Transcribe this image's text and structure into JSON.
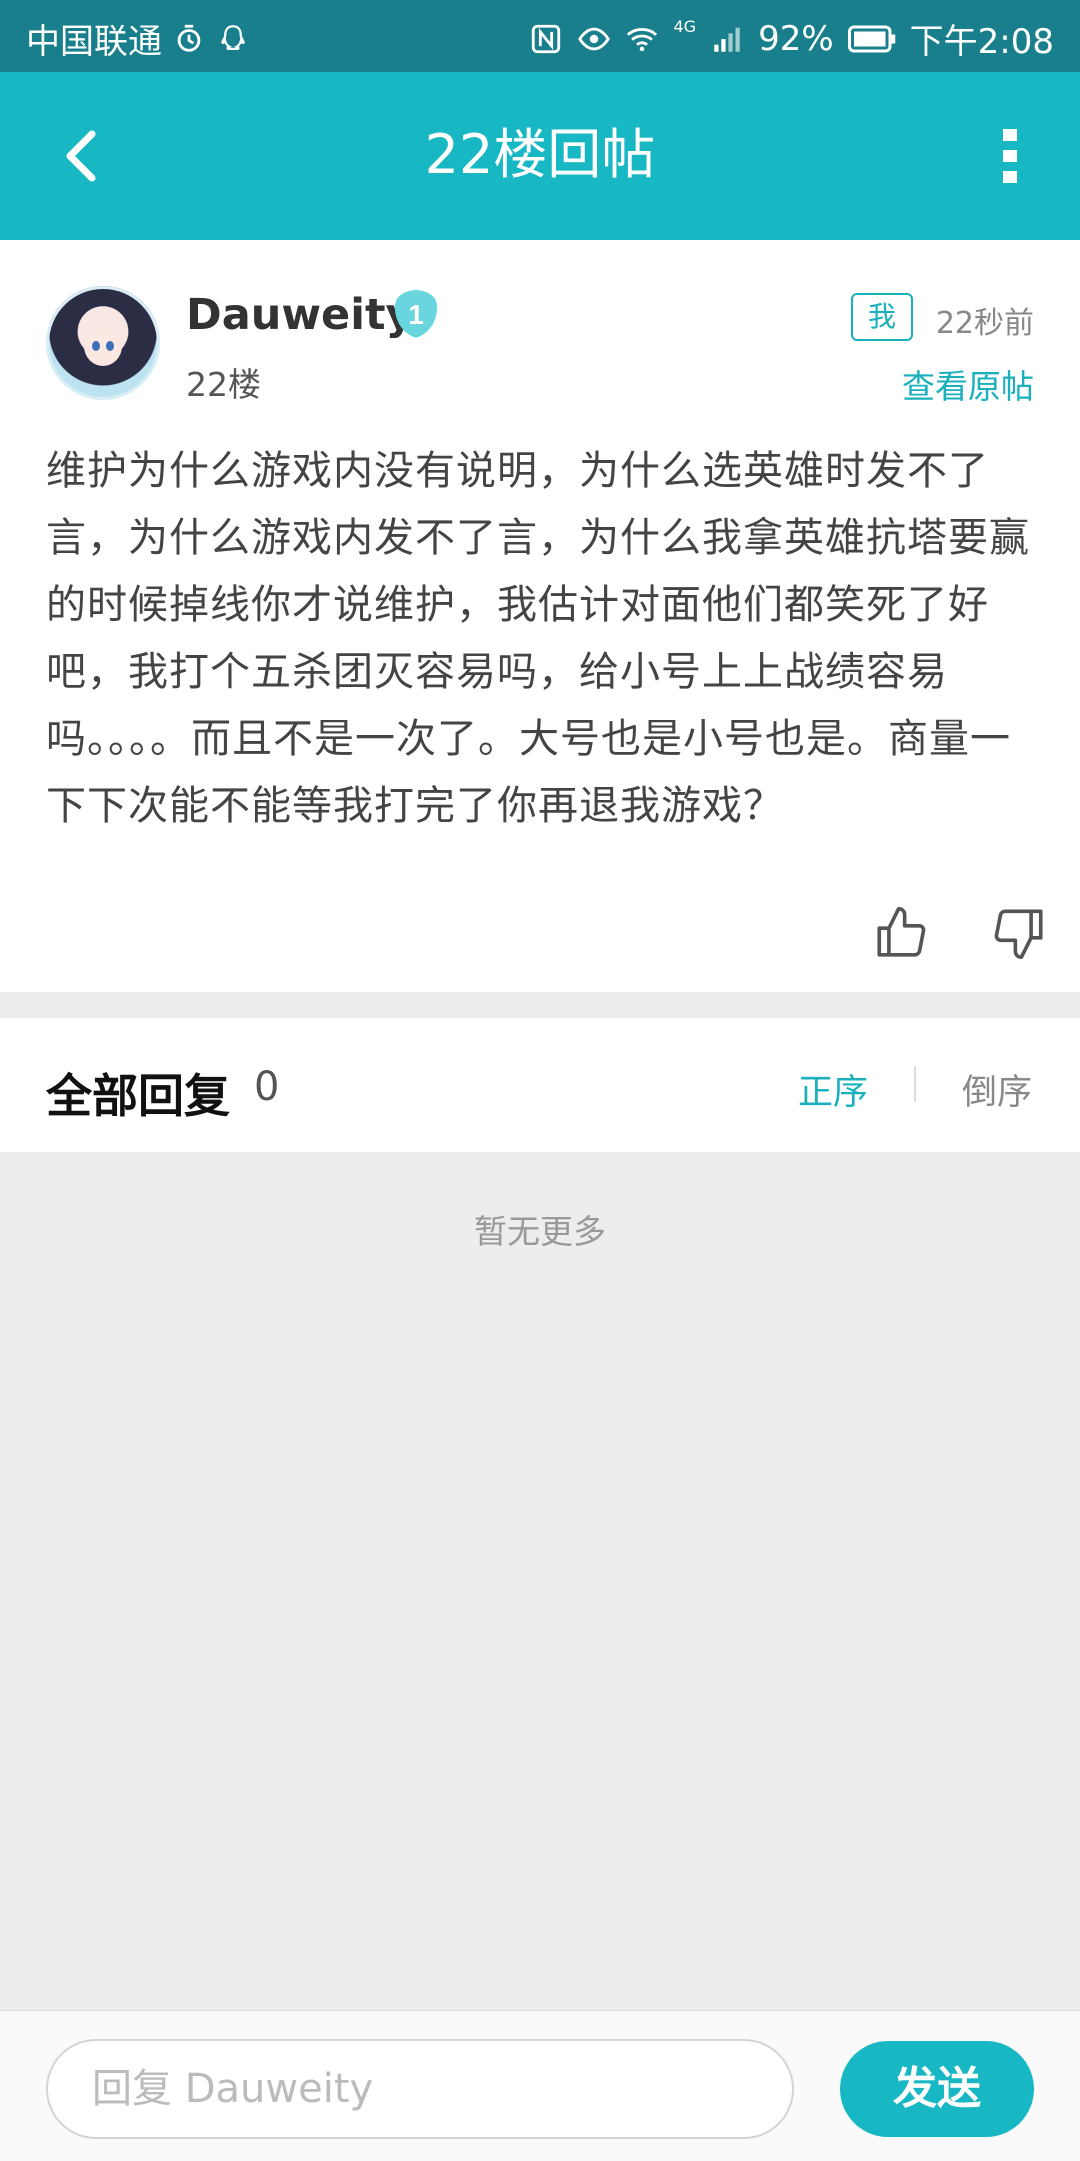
{
  "status_bar": {
    "carrier": "中国联通",
    "battery": "92%",
    "time": "下午2:08",
    "network": "4G",
    "icons": [
      "alarm-icon",
      "qq-icon",
      "nfc-icon",
      "eye-icon",
      "wifi-icon",
      "signal-icon",
      "battery-icon"
    ]
  },
  "app_bar": {
    "title": "22楼回帖",
    "back_icon": "back-arrow-icon",
    "more_icon": "more-vertical-icon"
  },
  "post": {
    "username": "Dauweity",
    "level": "1",
    "floor": "22楼",
    "me_badge": "我",
    "time": "22秒前",
    "view_original": "查看原帖",
    "content": "维护为什么游戏内没有说明，为什么选英雄时发不了言，为什么游戏内发不了言，为什么我拿英雄抗塔要赢的时候掉线你才说维护，我估计对面他们都笑死了好吧，我打个五杀团灭容易吗，给小号上上战绩容易吗。。。。而且不是一次了。大号也是小号也是。商量一下下次能不能等我打完了你再退我游戏？",
    "like_icon": "thumbs-up-icon",
    "dislike_icon": "thumbs-down-icon"
  },
  "replies": {
    "title": "全部回复",
    "count": "0",
    "sort_asc": "正序",
    "sort_desc": "倒序",
    "empty_text": "暂无更多"
  },
  "reply_bar": {
    "placeholder": "回复 Dauweity",
    "send_label": "发送"
  },
  "colors": {
    "accent": "#18b7c4",
    "status_bar": "#1a7f8c",
    "background": "#ededed"
  }
}
